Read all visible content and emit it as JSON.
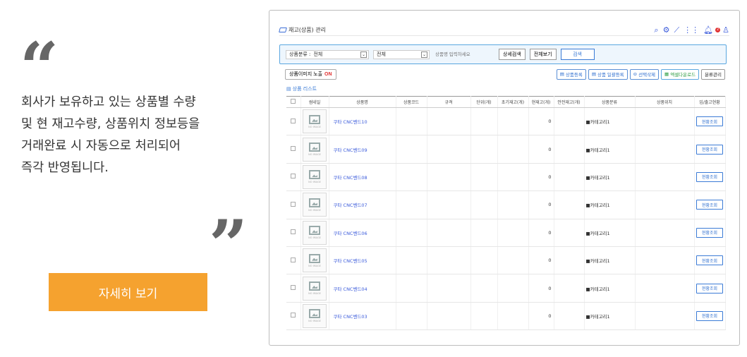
{
  "promo": {
    "description": "회사가 보유하고 있는 상품별 수량\n및 현 재고수량, 상품위치 정보등을\n거래완료 시 자동으로 처리되어\n즉각 반영됩니다.",
    "more_button": "자세히 보기",
    "accent_color": "#f5a22f"
  },
  "window": {
    "title": "재고(상품) 관리",
    "icons": [
      "search-icon",
      "gear-icon",
      "chart-icon",
      "grid-icon",
      "bell-icon",
      "user-icon"
    ],
    "bell_badge": "2"
  },
  "filter": {
    "category_label": "상품분류 :",
    "category_value": "전체",
    "type_value": "전체",
    "search_placeholder": "상품명 입력하세요",
    "detail_search": "상세검색",
    "view_all": "전체보기",
    "search": "검색"
  },
  "toolbar": {
    "image_toggle_label": "상품이미지 노출",
    "image_toggle_state": "ON",
    "register": "상품등록",
    "bulk_register": "상품 일괄등록",
    "delete_selected": "선택삭제",
    "excel_download": "엑셀다운로드",
    "category_manage": "분류관리"
  },
  "list": {
    "title": "상품 리스트",
    "columns": [
      "",
      "썸네일",
      "상품명",
      "상품코드",
      "규격",
      "단위(개)",
      "초기재고(개)",
      "현재고(개)",
      "안전재고(개)",
      "상품분류",
      "상품위치",
      "입/출고현황"
    ],
    "no_image": "NO IMAGE",
    "rows": [
      {
        "name": "쿠타 CNC벤드10",
        "stock": "0",
        "category": "■카테고리1",
        "action": "현황조회"
      },
      {
        "name": "쿠타 CNC벤드09",
        "stock": "0",
        "category": "■카테고리1",
        "action": "현황조회"
      },
      {
        "name": "쿠타 CNC벤드08",
        "stock": "0",
        "category": "■카테고리1",
        "action": "현황조회"
      },
      {
        "name": "쿠타 CNC벤드07",
        "stock": "0",
        "category": "■카테고리1",
        "action": "현황조회"
      },
      {
        "name": "쿠타 CNC벤드06",
        "stock": "0",
        "category": "■카테고리1",
        "action": "현황조회"
      },
      {
        "name": "쿠타 CNC벤드05",
        "stock": "0",
        "category": "■카테고리1",
        "action": "현황조회"
      },
      {
        "name": "쿠타 CNC벤드04",
        "stock": "0",
        "category": "■카테고리1",
        "action": "현황조회"
      },
      {
        "name": "쿠타 CNC벤드03",
        "stock": "0",
        "category": "■카테고리1",
        "action": "현황조회"
      }
    ]
  }
}
